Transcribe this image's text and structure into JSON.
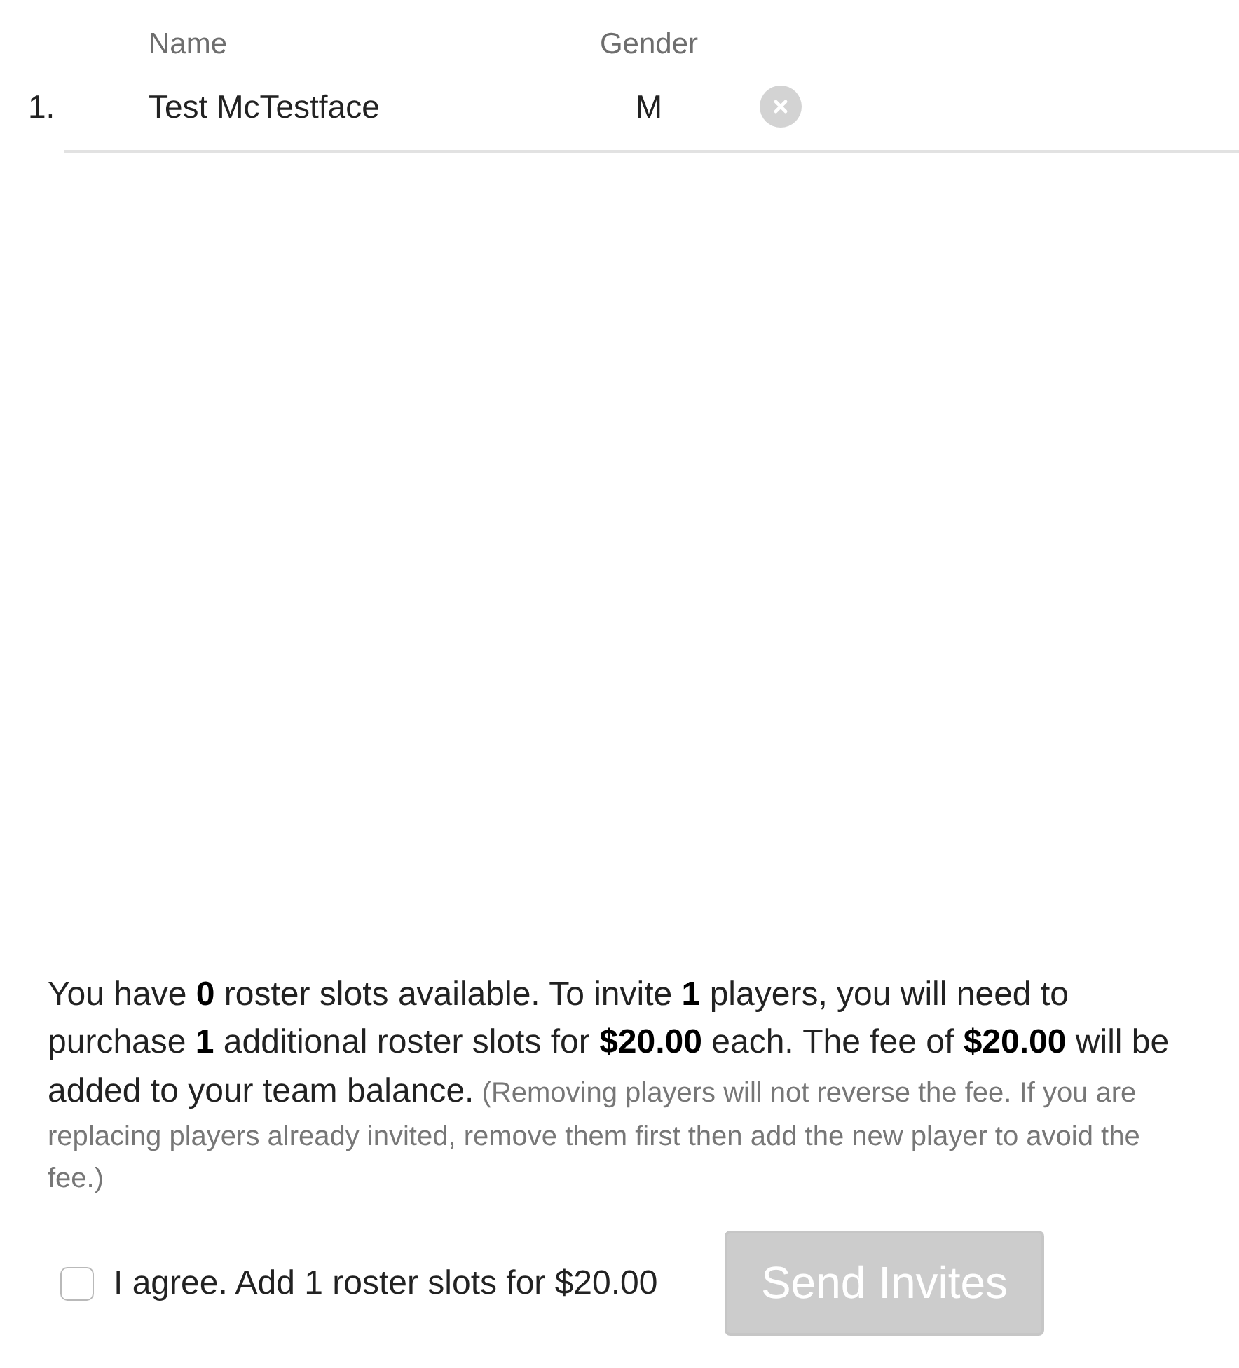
{
  "columns": {
    "name": "Name",
    "gender": "Gender"
  },
  "players": [
    {
      "number": "1.",
      "name": "Test McTestface",
      "gender": "M"
    }
  ],
  "notice": {
    "text": "You have **0** roster slots available. To invite **1** players, you will need to purchase **1** additional roster slots for **$20.00** each. The fee of **$20.00** will be added to your team balance.",
    "note": "(Removing players will not reverse the fee. If you are replacing players already invited, remove them first then add the new player to avoid the fee.)"
  },
  "agreement": {
    "label": "I agree. Add 1 roster slots for $20.00",
    "checked": false
  },
  "send_button": {
    "label": "Send Invites",
    "disabled": true
  }
}
